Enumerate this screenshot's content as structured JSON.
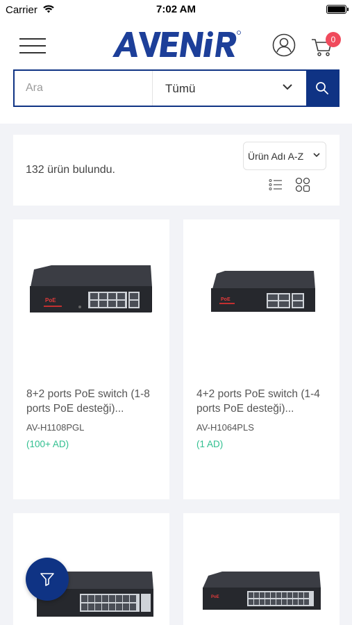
{
  "status_bar": {
    "carrier": "Carrier",
    "time": "7:02 AM"
  },
  "header": {
    "logo_text": "AVENIR",
    "cart_count": "0"
  },
  "search": {
    "placeholder": "Ara",
    "category_selected": "Tümü"
  },
  "results": {
    "count_text": "132 ürün bulundu.",
    "sort_selected": "Ürün Adı A-Z"
  },
  "products": [
    {
      "title": "8+2 ports PoE switch (1-8 ports PoE desteği)...",
      "sku": "AV-H1108PGL",
      "stock": "(100+ AD)"
    },
    {
      "title": "4+2 ports PoE switch (1-4 ports PoE desteği)...",
      "sku": "AV-H1064PLS",
      "stock": "(1 AD)"
    },
    {
      "title": "",
      "sku": "",
      "stock": ""
    },
    {
      "title": "",
      "sku": "",
      "stock": ""
    }
  ],
  "colors": {
    "brand_navy": "#0f3384",
    "badge_red": "#f04a5c",
    "stock_green": "#2fbf8f",
    "page_bg": "#f2f3f7"
  },
  "icons": {
    "menu": "hamburger-icon",
    "account": "user-circle-icon",
    "cart": "cart-icon",
    "search": "search-icon",
    "list_view": "list-view-icon",
    "grid_view": "grid-view-icon",
    "filter": "filter-funnel-icon"
  }
}
